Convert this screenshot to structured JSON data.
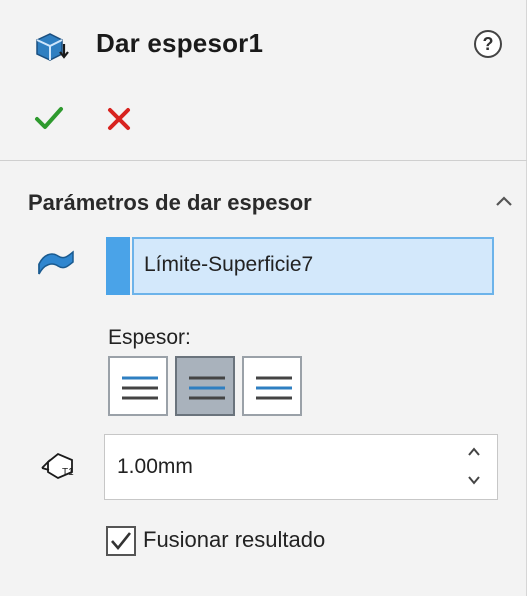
{
  "header": {
    "title": "Dar espesor1",
    "feature_icon": "thicken-feature-icon",
    "help_icon": "help-icon",
    "help_glyph": "?"
  },
  "actions": {
    "ok_icon": "checkmark-icon",
    "cancel_icon": "close-icon",
    "ok_color": "#2e9a2e",
    "cancel_color": "#d8231f"
  },
  "section": {
    "title": "Parámetros de dar espesor",
    "collapse_icon": "chevron-up-icon",
    "selection_value": "Límite-Superficie7",
    "thickness_label": "Espesor:",
    "side_buttons": [
      {
        "name": "thicken-side1",
        "icon": "thicken-side1-icon",
        "active": false
      },
      {
        "name": "thicken-both-sides",
        "icon": "thicken-both-sides-icon",
        "active": true
      },
      {
        "name": "thicken-side2",
        "icon": "thicken-side2-icon",
        "active": false
      }
    ],
    "thickness_value": "1.00mm",
    "merge_label": "Fusionar resultado",
    "merge_checked": true
  },
  "colors": {
    "selection_bg": "#d3e8fb",
    "selection_accent": "#4aa3e8"
  }
}
